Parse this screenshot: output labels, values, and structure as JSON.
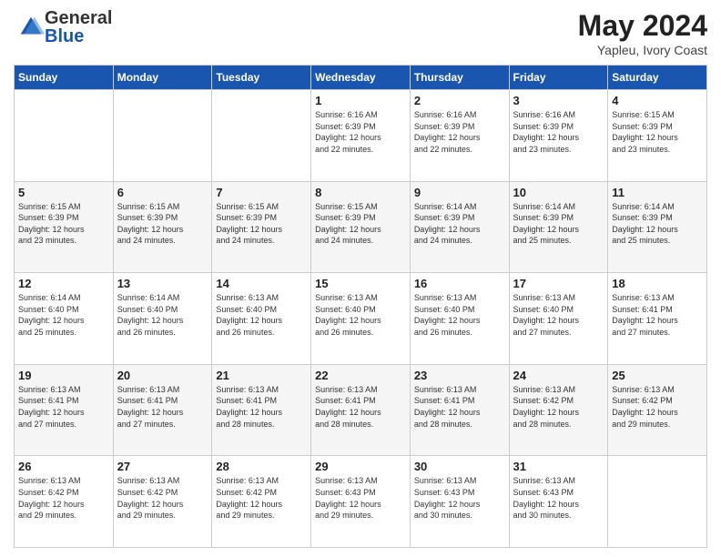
{
  "header": {
    "logo_general": "General",
    "logo_blue": "Blue",
    "month_title": "May 2024",
    "subtitle": "Yapleu, Ivory Coast"
  },
  "days_of_week": [
    "Sunday",
    "Monday",
    "Tuesday",
    "Wednesday",
    "Thursday",
    "Friday",
    "Saturday"
  ],
  "weeks": [
    [
      {
        "day": "",
        "info": ""
      },
      {
        "day": "",
        "info": ""
      },
      {
        "day": "",
        "info": ""
      },
      {
        "day": "1",
        "info": "Sunrise: 6:16 AM\nSunset: 6:39 PM\nDaylight: 12 hours\nand 22 minutes."
      },
      {
        "day": "2",
        "info": "Sunrise: 6:16 AM\nSunset: 6:39 PM\nDaylight: 12 hours\nand 22 minutes."
      },
      {
        "day": "3",
        "info": "Sunrise: 6:16 AM\nSunset: 6:39 PM\nDaylight: 12 hours\nand 23 minutes."
      },
      {
        "day": "4",
        "info": "Sunrise: 6:15 AM\nSunset: 6:39 PM\nDaylight: 12 hours\nand 23 minutes."
      }
    ],
    [
      {
        "day": "5",
        "info": "Sunrise: 6:15 AM\nSunset: 6:39 PM\nDaylight: 12 hours\nand 23 minutes."
      },
      {
        "day": "6",
        "info": "Sunrise: 6:15 AM\nSunset: 6:39 PM\nDaylight: 12 hours\nand 24 minutes."
      },
      {
        "day": "7",
        "info": "Sunrise: 6:15 AM\nSunset: 6:39 PM\nDaylight: 12 hours\nand 24 minutes."
      },
      {
        "day": "8",
        "info": "Sunrise: 6:15 AM\nSunset: 6:39 PM\nDaylight: 12 hours\nand 24 minutes."
      },
      {
        "day": "9",
        "info": "Sunrise: 6:14 AM\nSunset: 6:39 PM\nDaylight: 12 hours\nand 24 minutes."
      },
      {
        "day": "10",
        "info": "Sunrise: 6:14 AM\nSunset: 6:39 PM\nDaylight: 12 hours\nand 25 minutes."
      },
      {
        "day": "11",
        "info": "Sunrise: 6:14 AM\nSunset: 6:39 PM\nDaylight: 12 hours\nand 25 minutes."
      }
    ],
    [
      {
        "day": "12",
        "info": "Sunrise: 6:14 AM\nSunset: 6:40 PM\nDaylight: 12 hours\nand 25 minutes."
      },
      {
        "day": "13",
        "info": "Sunrise: 6:14 AM\nSunset: 6:40 PM\nDaylight: 12 hours\nand 26 minutes."
      },
      {
        "day": "14",
        "info": "Sunrise: 6:13 AM\nSunset: 6:40 PM\nDaylight: 12 hours\nand 26 minutes."
      },
      {
        "day": "15",
        "info": "Sunrise: 6:13 AM\nSunset: 6:40 PM\nDaylight: 12 hours\nand 26 minutes."
      },
      {
        "day": "16",
        "info": "Sunrise: 6:13 AM\nSunset: 6:40 PM\nDaylight: 12 hours\nand 26 minutes."
      },
      {
        "day": "17",
        "info": "Sunrise: 6:13 AM\nSunset: 6:40 PM\nDaylight: 12 hours\nand 27 minutes."
      },
      {
        "day": "18",
        "info": "Sunrise: 6:13 AM\nSunset: 6:41 PM\nDaylight: 12 hours\nand 27 minutes."
      }
    ],
    [
      {
        "day": "19",
        "info": "Sunrise: 6:13 AM\nSunset: 6:41 PM\nDaylight: 12 hours\nand 27 minutes."
      },
      {
        "day": "20",
        "info": "Sunrise: 6:13 AM\nSunset: 6:41 PM\nDaylight: 12 hours\nand 27 minutes."
      },
      {
        "day": "21",
        "info": "Sunrise: 6:13 AM\nSunset: 6:41 PM\nDaylight: 12 hours\nand 28 minutes."
      },
      {
        "day": "22",
        "info": "Sunrise: 6:13 AM\nSunset: 6:41 PM\nDaylight: 12 hours\nand 28 minutes."
      },
      {
        "day": "23",
        "info": "Sunrise: 6:13 AM\nSunset: 6:41 PM\nDaylight: 12 hours\nand 28 minutes."
      },
      {
        "day": "24",
        "info": "Sunrise: 6:13 AM\nSunset: 6:42 PM\nDaylight: 12 hours\nand 28 minutes."
      },
      {
        "day": "25",
        "info": "Sunrise: 6:13 AM\nSunset: 6:42 PM\nDaylight: 12 hours\nand 29 minutes."
      }
    ],
    [
      {
        "day": "26",
        "info": "Sunrise: 6:13 AM\nSunset: 6:42 PM\nDaylight: 12 hours\nand 29 minutes."
      },
      {
        "day": "27",
        "info": "Sunrise: 6:13 AM\nSunset: 6:42 PM\nDaylight: 12 hours\nand 29 minutes."
      },
      {
        "day": "28",
        "info": "Sunrise: 6:13 AM\nSunset: 6:42 PM\nDaylight: 12 hours\nand 29 minutes."
      },
      {
        "day": "29",
        "info": "Sunrise: 6:13 AM\nSunset: 6:43 PM\nDaylight: 12 hours\nand 29 minutes."
      },
      {
        "day": "30",
        "info": "Sunrise: 6:13 AM\nSunset: 6:43 PM\nDaylight: 12 hours\nand 30 minutes."
      },
      {
        "day": "31",
        "info": "Sunrise: 6:13 AM\nSunset: 6:43 PM\nDaylight: 12 hours\nand 30 minutes."
      },
      {
        "day": "",
        "info": ""
      }
    ]
  ]
}
